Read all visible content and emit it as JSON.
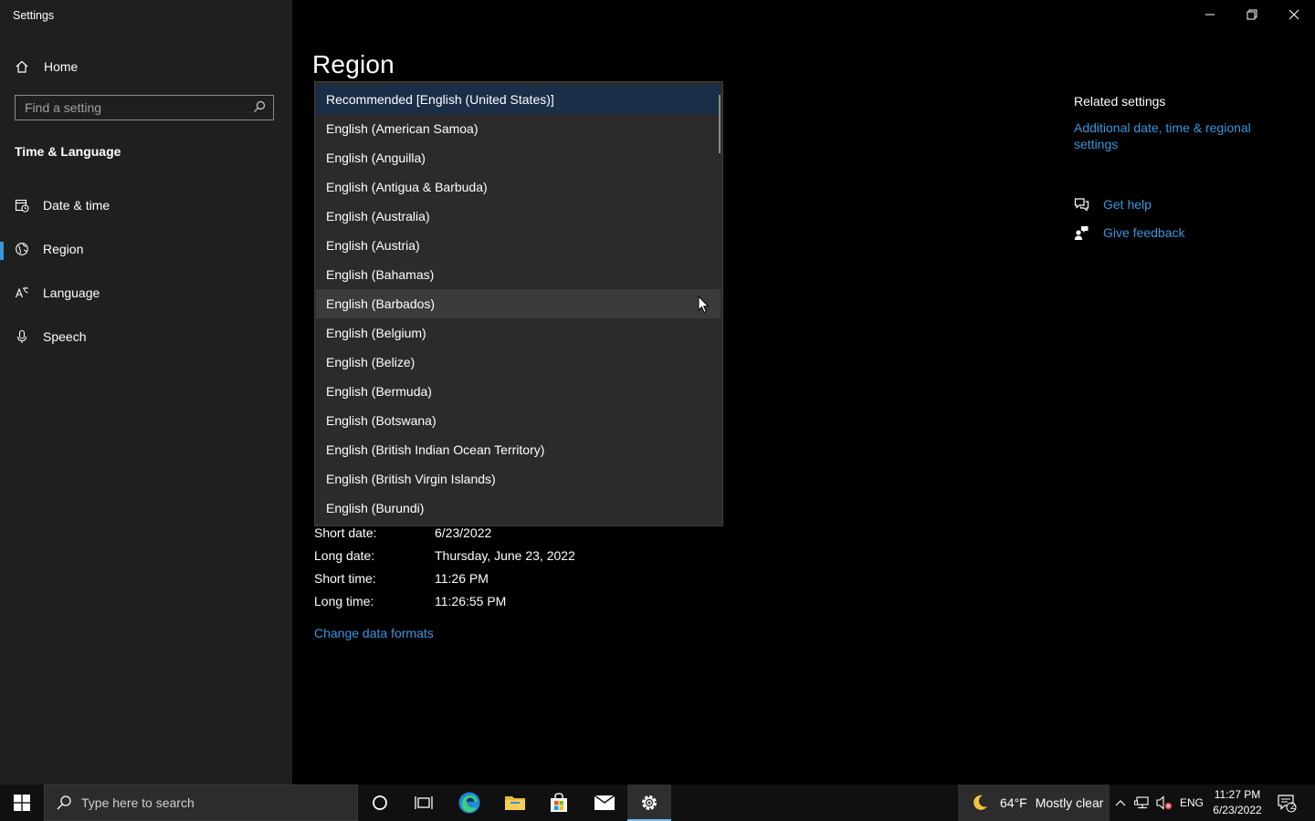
{
  "window": {
    "title": "Settings",
    "controls": {
      "minimize": "minimize",
      "restore": "restore",
      "close": "close"
    }
  },
  "sidebar": {
    "home_label": "Home",
    "search_placeholder": "Find a setting",
    "section_title": "Time & Language",
    "items": [
      {
        "label": "Date & time",
        "icon": "calendar-clock-icon",
        "active": false
      },
      {
        "label": "Region",
        "icon": "globe-icon",
        "active": true
      },
      {
        "label": "Language",
        "icon": "language-icon",
        "active": false
      },
      {
        "label": "Speech",
        "icon": "microphone-icon",
        "active": false
      }
    ]
  },
  "main": {
    "title": "Region",
    "dropdown": {
      "options": [
        "Recommended [English (United States)]",
        "English (American Samoa)",
        "English (Anguilla)",
        "English (Antigua & Barbuda)",
        "English (Australia)",
        "English (Austria)",
        "English (Bahamas)",
        "English (Barbados)",
        "English (Belgium)",
        "English (Belize)",
        "English (Bermuda)",
        "English (Botswana)",
        "English (British Indian Ocean Territory)",
        "English (British Virgin Islands)",
        "English (Burundi)"
      ],
      "selected": "Recommended [English (United States)]",
      "hovered": "English (Barbados)"
    },
    "formats": [
      {
        "label": "Short date:",
        "value": "6/23/2022"
      },
      {
        "label": "Long date:",
        "value": "Thursday, June 23, 2022"
      },
      {
        "label": "Short time:",
        "value": "11:26 PM"
      },
      {
        "label": "Long time:",
        "value": "11:26:55 PM"
      }
    ],
    "change_formats_link": "Change data formats"
  },
  "related": {
    "title": "Related settings",
    "link": "Additional date, time & regional settings",
    "get_help": "Get help",
    "give_feedback": "Give feedback"
  },
  "taskbar": {
    "search_placeholder": "Type here to search",
    "weather_temp": "64°F",
    "weather_desc": "Mostly clear",
    "language": "ENG",
    "time": "11:27 PM",
    "date": "6/23/2022",
    "notification_count": "2",
    "accent_color": "#76b9ed"
  },
  "colors": {
    "accent": "#3a96dd",
    "sidebar_bg": "#1f1f1f",
    "dropdown_bg": "#2b2b2b",
    "selected_bg": "#1a2f47"
  }
}
